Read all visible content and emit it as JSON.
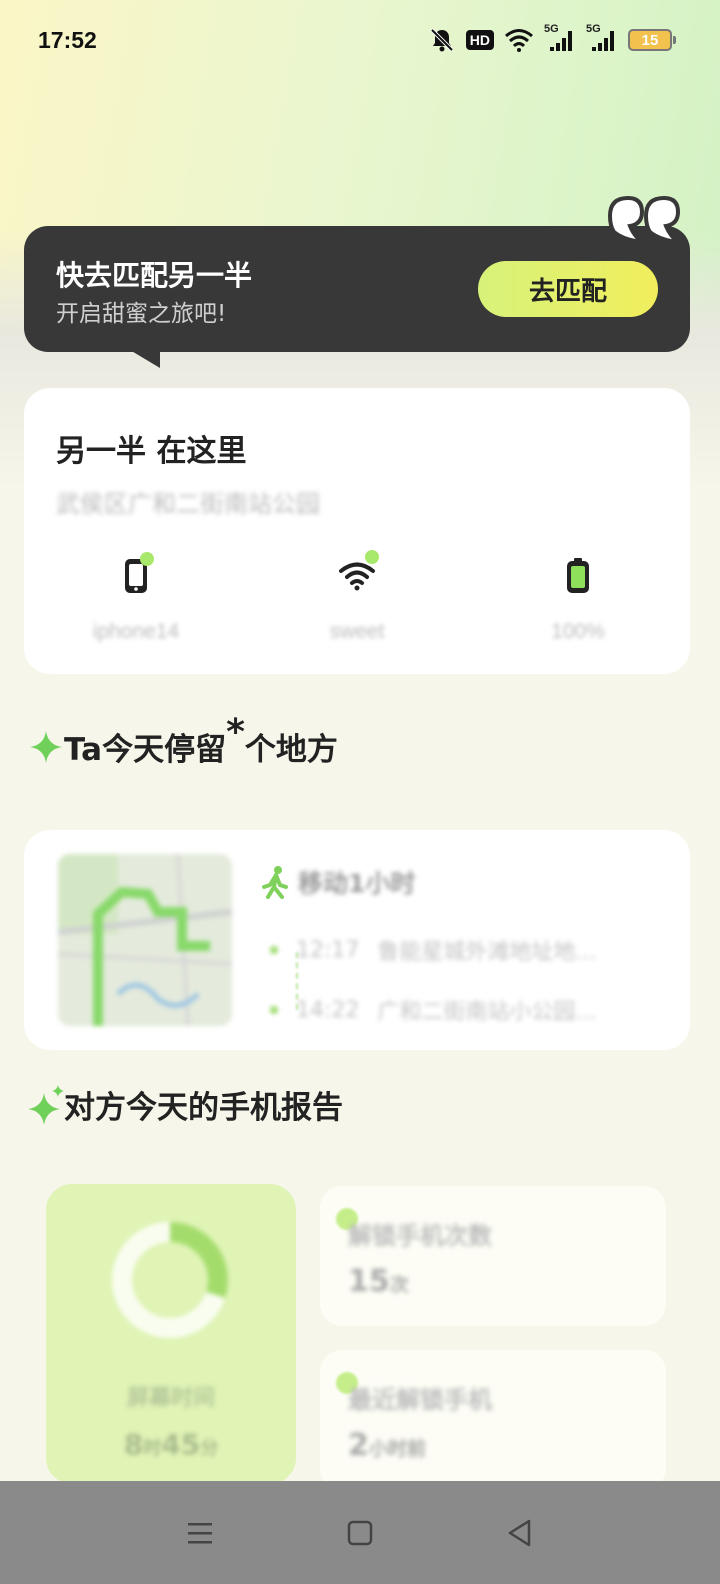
{
  "status_bar": {
    "time": "17:52",
    "hd_label": "HD",
    "signal_1_label": "5G",
    "signal_2_label": "5G",
    "battery_level": "15"
  },
  "banner": {
    "title": "快去匹配另一半",
    "subtitle": "开启甜蜜之旅吧!",
    "button_label": "去匹配"
  },
  "partner": {
    "title": "另一半 在这里",
    "address": "武侯区广和二街南站公园",
    "stats": [
      {
        "icon": "phone-icon",
        "label": "iphone14"
      },
      {
        "icon": "wifi-icon",
        "label": "sweet"
      },
      {
        "icon": "battery-icon",
        "label": "100%"
      }
    ]
  },
  "places_section": {
    "title_prefix": "Ta今天停留",
    "title_mark": "*",
    "title_suffix": "个地方"
  },
  "movement": {
    "head": "移动1小时",
    "entries": [
      {
        "time": "12:17",
        "place": "鲁能星城外滩地址地..."
      },
      {
        "time": "14:22",
        "place": "广和二街南站小公园..."
      }
    ]
  },
  "report_section": {
    "title": "对方今天的手机报告"
  },
  "report": {
    "screen_time_label": "屏幕时间",
    "screen_hours": "8",
    "hours_unit": "时",
    "screen_minutes": "45",
    "minutes_unit": "分",
    "screen_time_fraction": 0.3,
    "unlock_count_label": "解锁手机次数",
    "unlock_count_value": "15",
    "unlock_count_unit": "次",
    "last_unlock_label": "最近解锁手机",
    "last_unlock_value": "2",
    "last_unlock_unit": "小时前"
  },
  "colors": {
    "accent_green": "#a8e86a",
    "banner_bg": "#383838",
    "button_gradient_start": "#d7f27a",
    "button_gradient_end": "#f1ee5c"
  }
}
